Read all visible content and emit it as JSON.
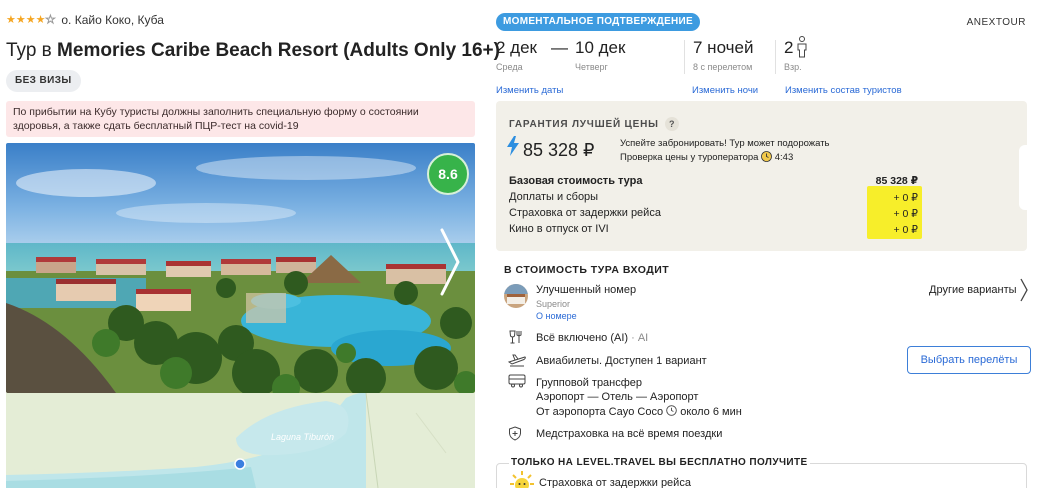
{
  "hotel": {
    "star_rating": 4,
    "star_max": 5,
    "location": "о. Кайо Коко, Куба",
    "title_prefix": "Тур в",
    "title_name": "Memories Caribe Beach Resort (Adults Only 16+)",
    "visa_badge": "БЕЗ ВИЗЫ",
    "covid_notice": "По прибытии на Кубу туристы должны заполнить специальную форму о состоянии здоровья, а также сдать бесплатный ПЦР-тест на covid-19",
    "rating": "8.6",
    "map_label": "Laguna Tiburón"
  },
  "booking": {
    "instant_badge": "МОМЕНТАЛЬНОЕ ПОДТВЕРЖДЕНИЕ",
    "operator": "ANEXTOUR",
    "date_from": "2 дек",
    "date_dash": "—",
    "date_to": "10 дек",
    "day_from": "Среда",
    "day_to": "Четверг",
    "nights": "7 ночей",
    "nights_note": "8 с перелетом",
    "adults": "2",
    "adults_note": "Взр.",
    "change_dates": "Изменить даты",
    "change_nights": "Изменить ночи",
    "change_tourists": "Изменить состав туристов"
  },
  "price": {
    "guarantee": "ГАРАНТИЯ ЛУЧШЕЙ ЦЕНЫ",
    "qmark": "?",
    "total": "85 328 ₽",
    "hurry_line1": "Успейте забронировать! Тур может подорожать",
    "hurry_line2": "Проверка цены у туроператора",
    "timer": "4:43",
    "rows": [
      {
        "label": "Базовая стоимость тура",
        "value": "85 328 ₽"
      },
      {
        "label": "Доплаты и сборы",
        "value": "+ 0 ₽"
      },
      {
        "label": "Страховка от задержки рейса",
        "value": "+ 0 ₽"
      },
      {
        "label": "Кино в отпуск от IVI",
        "value": "+ 0 ₽"
      }
    ]
  },
  "included": {
    "heading": "В СТОИМОСТЬ ТУРА ВХОДИТ",
    "room_name": "Улучшенный номер",
    "room_type": "Superior",
    "room_link": "О номере",
    "other_variants": "Другие варианты",
    "meal": "Всё включено (AI)",
    "meal_code": "· AI",
    "flights": "Авиабилеты. Доступен 1 вариант",
    "flights_button": "Выбрать перелёты",
    "transfer": "Групповой трансфер",
    "transfer_route": "Аэропорт — Отель — Аэропорт",
    "transfer_from": "От аэропорта Cayo Coco",
    "transfer_time": "около 6 мин",
    "insurance": "Медстраховка на всё время поездки"
  },
  "bonus": {
    "heading": "ТОЛЬКО НА LEVEL.TRAVEL ВЫ БЕСПЛАТНО ПОЛУЧИТЕ",
    "item1": "Страховка от задержки рейса"
  },
  "colors": {
    "accent_blue": "#3d9be0",
    "link_blue": "#2a6ad6",
    "rating_green": "#37b34a",
    "highlight_yellow": "#f7ee2a",
    "covid_bg": "#fde7e8",
    "price_card_bg": "#f2f0e9"
  }
}
